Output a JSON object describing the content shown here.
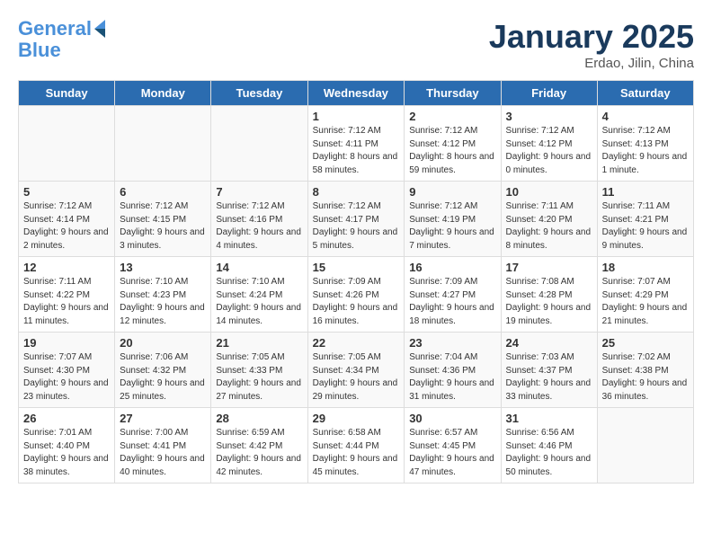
{
  "header": {
    "logo_line1": "General",
    "logo_line2": "Blue",
    "title": "January 2025",
    "location": "Erdao, Jilin, China"
  },
  "days_of_week": [
    "Sunday",
    "Monday",
    "Tuesday",
    "Wednesday",
    "Thursday",
    "Friday",
    "Saturday"
  ],
  "weeks": [
    [
      {
        "day": "",
        "info": ""
      },
      {
        "day": "",
        "info": ""
      },
      {
        "day": "",
        "info": ""
      },
      {
        "day": "1",
        "info": "Sunrise: 7:12 AM\nSunset: 4:11 PM\nDaylight: 8 hours and 58 minutes."
      },
      {
        "day": "2",
        "info": "Sunrise: 7:12 AM\nSunset: 4:12 PM\nDaylight: 8 hours and 59 minutes."
      },
      {
        "day": "3",
        "info": "Sunrise: 7:12 AM\nSunset: 4:12 PM\nDaylight: 9 hours and 0 minutes."
      },
      {
        "day": "4",
        "info": "Sunrise: 7:12 AM\nSunset: 4:13 PM\nDaylight: 9 hours and 1 minute."
      }
    ],
    [
      {
        "day": "5",
        "info": "Sunrise: 7:12 AM\nSunset: 4:14 PM\nDaylight: 9 hours and 2 minutes."
      },
      {
        "day": "6",
        "info": "Sunrise: 7:12 AM\nSunset: 4:15 PM\nDaylight: 9 hours and 3 minutes."
      },
      {
        "day": "7",
        "info": "Sunrise: 7:12 AM\nSunset: 4:16 PM\nDaylight: 9 hours and 4 minutes."
      },
      {
        "day": "8",
        "info": "Sunrise: 7:12 AM\nSunset: 4:17 PM\nDaylight: 9 hours and 5 minutes."
      },
      {
        "day": "9",
        "info": "Sunrise: 7:12 AM\nSunset: 4:19 PM\nDaylight: 9 hours and 7 minutes."
      },
      {
        "day": "10",
        "info": "Sunrise: 7:11 AM\nSunset: 4:20 PM\nDaylight: 9 hours and 8 minutes."
      },
      {
        "day": "11",
        "info": "Sunrise: 7:11 AM\nSunset: 4:21 PM\nDaylight: 9 hours and 9 minutes."
      }
    ],
    [
      {
        "day": "12",
        "info": "Sunrise: 7:11 AM\nSunset: 4:22 PM\nDaylight: 9 hours and 11 minutes."
      },
      {
        "day": "13",
        "info": "Sunrise: 7:10 AM\nSunset: 4:23 PM\nDaylight: 9 hours and 12 minutes."
      },
      {
        "day": "14",
        "info": "Sunrise: 7:10 AM\nSunset: 4:24 PM\nDaylight: 9 hours and 14 minutes."
      },
      {
        "day": "15",
        "info": "Sunrise: 7:09 AM\nSunset: 4:26 PM\nDaylight: 9 hours and 16 minutes."
      },
      {
        "day": "16",
        "info": "Sunrise: 7:09 AM\nSunset: 4:27 PM\nDaylight: 9 hours and 18 minutes."
      },
      {
        "day": "17",
        "info": "Sunrise: 7:08 AM\nSunset: 4:28 PM\nDaylight: 9 hours and 19 minutes."
      },
      {
        "day": "18",
        "info": "Sunrise: 7:07 AM\nSunset: 4:29 PM\nDaylight: 9 hours and 21 minutes."
      }
    ],
    [
      {
        "day": "19",
        "info": "Sunrise: 7:07 AM\nSunset: 4:30 PM\nDaylight: 9 hours and 23 minutes."
      },
      {
        "day": "20",
        "info": "Sunrise: 7:06 AM\nSunset: 4:32 PM\nDaylight: 9 hours and 25 minutes."
      },
      {
        "day": "21",
        "info": "Sunrise: 7:05 AM\nSunset: 4:33 PM\nDaylight: 9 hours and 27 minutes."
      },
      {
        "day": "22",
        "info": "Sunrise: 7:05 AM\nSunset: 4:34 PM\nDaylight: 9 hours and 29 minutes."
      },
      {
        "day": "23",
        "info": "Sunrise: 7:04 AM\nSunset: 4:36 PM\nDaylight: 9 hours and 31 minutes."
      },
      {
        "day": "24",
        "info": "Sunrise: 7:03 AM\nSunset: 4:37 PM\nDaylight: 9 hours and 33 minutes."
      },
      {
        "day": "25",
        "info": "Sunrise: 7:02 AM\nSunset: 4:38 PM\nDaylight: 9 hours and 36 minutes."
      }
    ],
    [
      {
        "day": "26",
        "info": "Sunrise: 7:01 AM\nSunset: 4:40 PM\nDaylight: 9 hours and 38 minutes."
      },
      {
        "day": "27",
        "info": "Sunrise: 7:00 AM\nSunset: 4:41 PM\nDaylight: 9 hours and 40 minutes."
      },
      {
        "day": "28",
        "info": "Sunrise: 6:59 AM\nSunset: 4:42 PM\nDaylight: 9 hours and 42 minutes."
      },
      {
        "day": "29",
        "info": "Sunrise: 6:58 AM\nSunset: 4:44 PM\nDaylight: 9 hours and 45 minutes."
      },
      {
        "day": "30",
        "info": "Sunrise: 6:57 AM\nSunset: 4:45 PM\nDaylight: 9 hours and 47 minutes."
      },
      {
        "day": "31",
        "info": "Sunrise: 6:56 AM\nSunset: 4:46 PM\nDaylight: 9 hours and 50 minutes."
      },
      {
        "day": "",
        "info": ""
      }
    ]
  ]
}
